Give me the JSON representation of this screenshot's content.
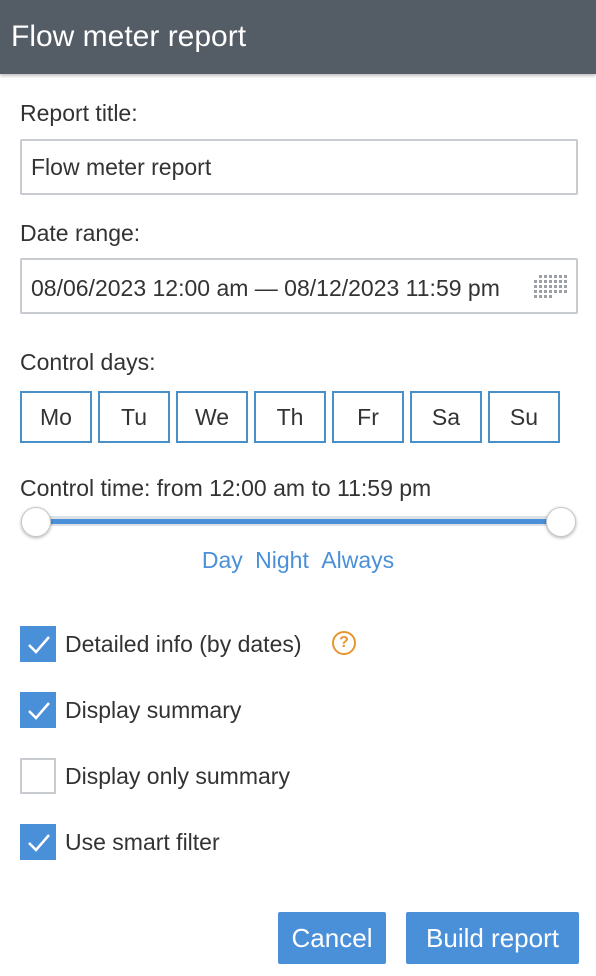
{
  "window": {
    "title": "Flow meter report"
  },
  "form": {
    "report_title_label": "Report title:",
    "report_title_value": "Flow meter report",
    "date_range_label": "Date range:",
    "date_range_value": "08/06/2023 12:00 am — 08/12/2023 11:59 pm",
    "control_days_label": "Control days:",
    "days": [
      "Mo",
      "Tu",
      "We",
      "Th",
      "Fr",
      "Sa",
      "Su"
    ],
    "control_time_label": "Control time: from 12:00 am to 11:59 pm",
    "time_presets": [
      "Day",
      "Night",
      "Always"
    ],
    "slider": {
      "from": "12:00 am",
      "to": "11:59 pm"
    },
    "options": [
      {
        "label": "Detailed info (by dates)",
        "checked": true,
        "help_icon": "question-circle-icon"
      },
      {
        "label": "Display summary",
        "checked": true
      },
      {
        "label": "Display only summary",
        "checked": false
      },
      {
        "label": "Use smart filter",
        "checked": true
      }
    ]
  },
  "buttons": {
    "cancel": "Cancel",
    "build": "Build report"
  },
  "colors": {
    "header_bg": "#545c66",
    "accent": "#4a90d9",
    "day_border": "#4a90c8",
    "help_icon": "#e8962f"
  },
  "icons": {
    "calendar": "calendar-grid-icon",
    "check": "checkmark-icon",
    "help": "question-circle-icon"
  }
}
